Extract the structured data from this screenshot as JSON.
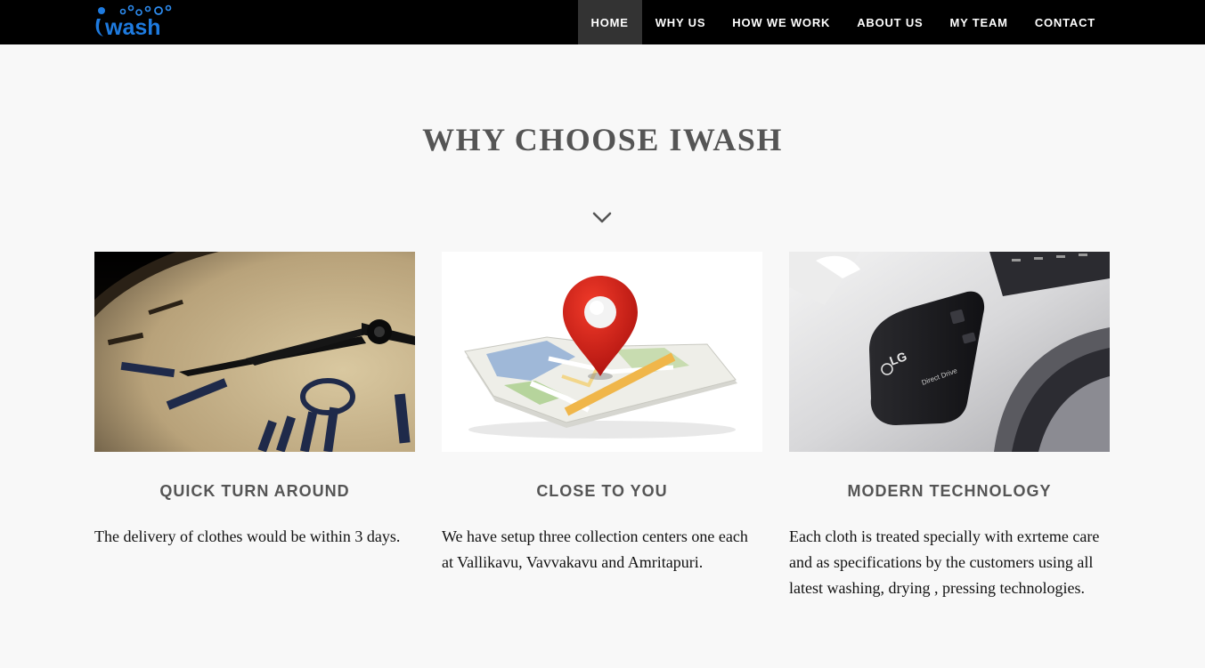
{
  "brand": {
    "logo_text": "wash",
    "logo_icon": "iwash-logo-icon",
    "accent": "#1e7be0"
  },
  "nav": {
    "items": [
      {
        "label": "HOME",
        "active": true
      },
      {
        "label": "WHY US"
      },
      {
        "label": "HOW WE WORK"
      },
      {
        "label": "ABOUT US"
      },
      {
        "label": "MY TEAM"
      },
      {
        "label": "CONTACT"
      }
    ]
  },
  "section": {
    "title": "WHY CHOOSE IWASH",
    "chevron_icon": "chevron-down-icon"
  },
  "features": [
    {
      "image": "clock-image",
      "title": "QUICK TURN AROUND",
      "text": "The delivery of clothes would be within 3 days."
    },
    {
      "image": "map-pin-image",
      "title": "CLOSE TO YOU",
      "text": "We have setup three collection centers one each at Vallikavu, Vavvakavu and Amritapuri."
    },
    {
      "image": "washing-machine-image",
      "title": "MODERN TECHNOLOGY",
      "text": "Each cloth is treated specially with exrteme care and as specifications by the customers using all latest washing, drying , pressing technologies.",
      "machine_brand": "LG",
      "machine_panel_text": "Direct Drive"
    }
  ]
}
